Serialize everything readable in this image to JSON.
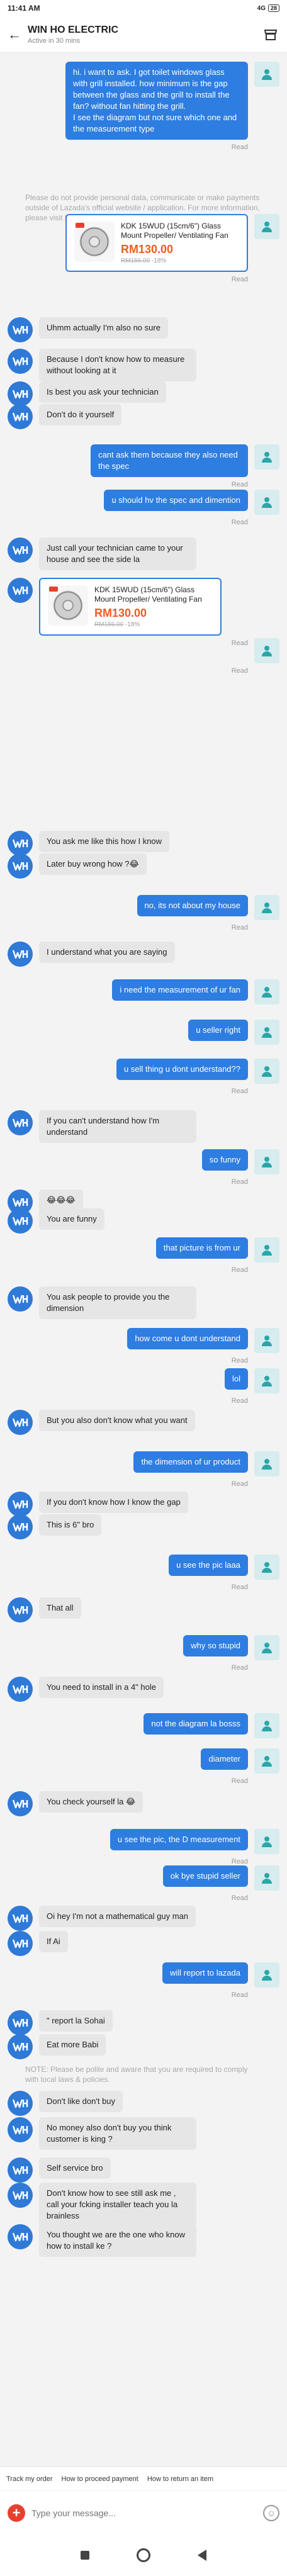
{
  "status_bar": {
    "time": "11:41 AM",
    "network": "4G",
    "battery": "28"
  },
  "header": {
    "title": "WIN HO ELECTRIC",
    "subtitle": "Active in 30 mins"
  },
  "product_card": {
    "name": "KDK 15WUD (15cm/6\") Glass Mount Propeller/ Ventilating Fan",
    "price": "RM130.00",
    "old_price": "RM156.00",
    "discount": "-18%"
  },
  "messages": [
    {
      "side": "out",
      "text": "hi. i want to ask. I got toilet windows glass with grill installed. how minimum is the gap between the glass and the grill to install the fan? without fan hitting the grill.\nI see the diagram but not sure which one and the measurement type",
      "read": "Read"
    },
    {
      "side": "notice",
      "text": "Please do not provide personal data, communicate or make payments outside of Lazada's official website / application. For more information, please visit Lazada Customer Care section."
    },
    {
      "side": "out-product",
      "read": "Read"
    },
    {
      "side": "in",
      "text": "Uhmm actually I'm also no sure"
    },
    {
      "side": "in",
      "text": "Because I don't know how to measure without looking at it"
    },
    {
      "side": "in",
      "text": "Is best you ask your technician"
    },
    {
      "side": "in",
      "text": "Don't do it yourself"
    },
    {
      "side": "out",
      "text": "cant ask them because they also need the spec",
      "read": "Read"
    },
    {
      "side": "out",
      "text": "u should hv the spec and dimention",
      "read": "Read"
    },
    {
      "side": "in",
      "text": "Just call your technician came to your house and see the side la"
    },
    {
      "side": "in-product",
      "read": "Read"
    },
    {
      "side": "out-blank",
      "read": "Read"
    },
    {
      "side": "in",
      "text": "You ask me like this how I know"
    },
    {
      "side": "in",
      "text": "Later buy wrong how ?😂"
    },
    {
      "side": "out",
      "text": "no, its not about my house",
      "read": "Read"
    },
    {
      "side": "in",
      "text": "I understand what you are saying"
    },
    {
      "side": "out",
      "text": "i need the measurement of ur fan"
    },
    {
      "side": "out",
      "text": "u seller right"
    },
    {
      "side": "out",
      "text": "u sell thing u dont understand??",
      "read": "Read"
    },
    {
      "side": "in",
      "text": "If you can't understand how I'm understand"
    },
    {
      "side": "out",
      "text": "so funny",
      "read": "Read"
    },
    {
      "side": "in",
      "text": "😂😂😂"
    },
    {
      "side": "in",
      "text": "You are funny"
    },
    {
      "side": "out",
      "text": "that picture is from ur",
      "read": "Read"
    },
    {
      "side": "in",
      "text": "You ask people to provide you the dimension"
    },
    {
      "side": "out",
      "text": "how come u dont understand",
      "read": "Read"
    },
    {
      "side": "out",
      "text": "lol",
      "read": "Read"
    },
    {
      "side": "in",
      "text": "But you also don't know what you want"
    },
    {
      "side": "out",
      "text": "the dimension of ur product",
      "read": "Read"
    },
    {
      "side": "in",
      "text": "If you don't know how I know the gap"
    },
    {
      "side": "in",
      "text": "This is 6\" bro"
    },
    {
      "side": "out",
      "text": "u see the pic laaa",
      "read": "Read"
    },
    {
      "side": "in",
      "text": "That all"
    },
    {
      "side": "out",
      "text": "why so stupid",
      "read": "Read"
    },
    {
      "side": "in",
      "text": "You need to install in a 4\" hole"
    },
    {
      "side": "out",
      "text": "not the diagram la bosss"
    },
    {
      "side": "out",
      "text": "diameter",
      "read": "Read"
    },
    {
      "side": "in",
      "text": "You check yourself la 😂"
    },
    {
      "side": "out",
      "text": "u see the pic, the D measurement",
      "read": "Read"
    },
    {
      "side": "out",
      "text": "ok bye stupid seller",
      "read": "Read"
    },
    {
      "side": "in",
      "text": "Oi hey I'm not a mathematical guy man"
    },
    {
      "side": "in",
      "text": "If Ai"
    },
    {
      "side": "out",
      "text": "will report to lazada",
      "read": "Read"
    },
    {
      "side": "in",
      "text": "\" report la Sohai"
    },
    {
      "side": "in",
      "text": "Eat more Babi"
    },
    {
      "side": "notice",
      "text": "NOTE: Please be polite and aware that you are required to comply with local laws & policies."
    },
    {
      "side": "in",
      "text": "Don't like don't buy"
    },
    {
      "side": "in",
      "text": "No money also don't buy you think customer is king ?"
    },
    {
      "side": "in",
      "text": "Self service bro"
    },
    {
      "side": "in",
      "text": "Don't know how to see still ask me , call your fcking installer teach you la brainless"
    },
    {
      "side": "in",
      "text": "You thought we are the one who know how to install ke ?"
    }
  ],
  "quick_replies": [
    "Track my order",
    "How to proceed payment",
    "How to return an item"
  ],
  "composer": {
    "placeholder": "Type your message..."
  }
}
